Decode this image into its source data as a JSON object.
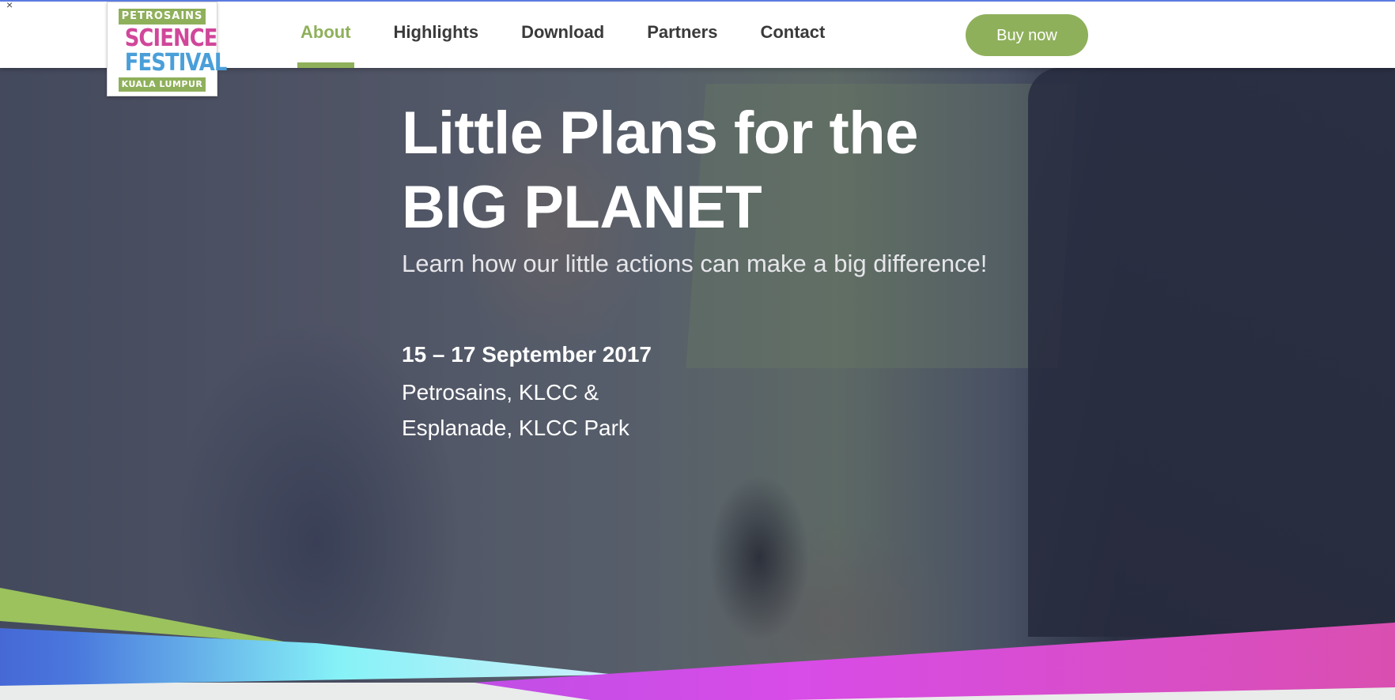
{
  "corner_mark": "×",
  "logo": {
    "line1": "PETROSAINS",
    "line2": "SCIENCE",
    "line3": "FESTIVAL",
    "line4": "KUALA LUMPUR"
  },
  "nav": {
    "items": [
      {
        "label": "About",
        "active": true
      },
      {
        "label": "Highlights",
        "active": false
      },
      {
        "label": "Download",
        "active": false
      },
      {
        "label": "Partners",
        "active": false
      },
      {
        "label": "Contact",
        "active": false
      }
    ],
    "cta_label": "Buy now"
  },
  "hero": {
    "title_line1": "Little Plans for the",
    "title_line2": "BIG PLANET",
    "subtitle": "Learn how our little actions can make a big difference!",
    "date": "15 – 17 September 2017",
    "venue_line1": "Petrosains, KLCC &",
    "venue_line2": "Esplanade, KLCC Park"
  },
  "colors": {
    "accent_green": "#8fb05b",
    "logo_pink": "#d0479a",
    "logo_blue": "#4a9fd9",
    "nav_text": "#3a3a3a",
    "ribbon_pink": "#d94ddf",
    "ribbon_cyan": "#86f2f7",
    "ribbon_blue": "#4a6fd8"
  }
}
